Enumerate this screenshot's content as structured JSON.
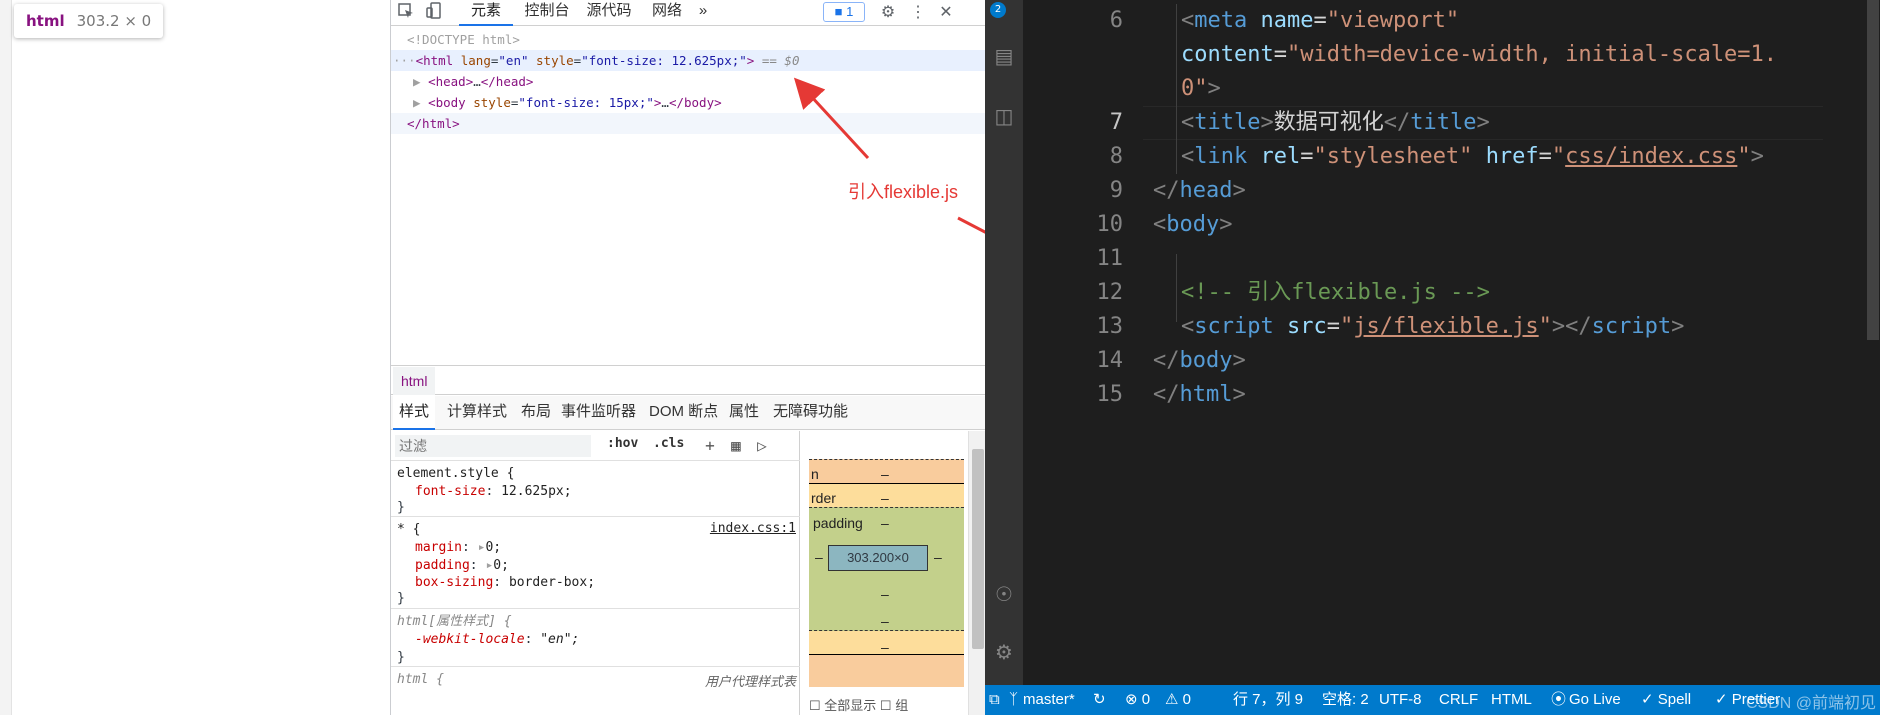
{
  "preview": {
    "tooltip": {
      "tag": "html",
      "dims": "303.2 × 0"
    }
  },
  "devtools": {
    "tabs": [
      "元素",
      "控制台",
      "源代码",
      "网络"
    ],
    "more_tabs": "»",
    "issues_count": "1",
    "dom": {
      "doctype": "<!DOCTYPE html>",
      "html_open": {
        "prefix": "···",
        "tag_open": "<html",
        "attr1_name": "lang",
        "attr1_value": "\"en\"",
        "attr2_name": "style",
        "attr2_value": "\"font-size: 12.625px;\"",
        "tag_close": ">",
        "suffix": "== $0"
      },
      "head_line": {
        "tag_open": "<head>",
        "ellipsis": "…",
        "tag_close": "</head>"
      },
      "body_line": {
        "tag_open": "<body",
        "attr_name": "style",
        "attr_value": "\"font-size: 15px;\"",
        "gt": ">",
        "ellipsis": "…",
        "tag_close": "</body>"
      },
      "html_close": "</html>"
    },
    "breadcrumb": "html",
    "sub_tabs": [
      "样式",
      "计算样式",
      "布局",
      "事件监听器",
      "DOM 断点",
      "属性",
      "无障碍功能"
    ],
    "filter": {
      "placeholder": "过滤",
      "hov": ":hov",
      "cls": ".cls",
      "add": "+"
    },
    "styles": {
      "rule1": {
        "selector": "element.style {",
        "prop": "font-size",
        "value": "12.625px;",
        "close": "}"
      },
      "rule2": {
        "selector": "* {",
        "source": "index.css:1",
        "props": [
          {
            "name": "margin",
            "value": "0;"
          },
          {
            "name": "padding",
            "value": "0;"
          },
          {
            "name": "box-sizing",
            "value": "border-box;"
          }
        ],
        "close": "}"
      },
      "rule3": {
        "selector": "html[属性样式] {",
        "prop": "-webkit-locale",
        "value": "\"en\";",
        "close": "}"
      },
      "rule4": {
        "selector": "html {",
        "source": "用户代理样式表"
      }
    },
    "box_model": {
      "margin_label": "n",
      "margin_value": "–",
      "border_label": "rder",
      "border_value": "–",
      "padding_label": "padding",
      "padding_value": "–",
      "content": "303.200×0",
      "dash": "–",
      "colors": {
        "margin": "#f9cc9d",
        "border": "#fddd9b",
        "padding": "#c3d08b",
        "content": "#8cb6c0"
      }
    },
    "bottom_hint": {
      "show_all": "全部显示",
      "group": "组"
    }
  },
  "annotation": {
    "label": "引入flexible.js",
    "color": "#e53935"
  },
  "vscode": {
    "badge": "2",
    "lines": [
      {
        "n": "6"
      },
      {
        "n": ""
      },
      {
        "n": ""
      },
      {
        "n": "7"
      },
      {
        "n": "8"
      },
      {
        "n": "9"
      },
      {
        "n": "10"
      },
      {
        "n": "11"
      },
      {
        "n": "12"
      },
      {
        "n": "13"
      },
      {
        "n": "14"
      },
      {
        "n": "15"
      }
    ],
    "code": {
      "l6": {
        "lt": "<",
        "tag": "meta",
        "attr": "name",
        "eq": "=",
        "val": "\"viewport\""
      },
      "l6b": {
        "attr": "content",
        "eq": "=",
        "val": "\"width=device-width, initial-scale=1."
      },
      "l6c": {
        "val": "0\"",
        "gt": ">"
      },
      "l7": {
        "lt": "<",
        "tag": "title",
        "gt": ">",
        "text": "数据可视化",
        "lt2": "</",
        "tag2": "title",
        "gt2": ">"
      },
      "l8": {
        "lt": "<",
        "tag": "link",
        "attr1": "rel",
        "eq1": "=",
        "val1": "\"stylesheet\"",
        "attr2": "href",
        "eq2": "=",
        "q1": "\"",
        "link": "css/index.css",
        "q2": "\"",
        "gt": ">"
      },
      "l9": {
        "lt": "</",
        "tag": "head",
        "gt": ">"
      },
      "l10": {
        "lt": "<",
        "tag": "body",
        "gt": ">"
      },
      "l12": {
        "comment": "<!-- 引入flexible.js -->"
      },
      "l13": {
        "lt": "<",
        "tag": "script",
        "attr": "src",
        "eq": "=",
        "q1": "\"",
        "link": "js/flexible.js",
        "q2": "\"",
        "gt": ">",
        "lt2": "</",
        "tag2": "script",
        "gt2": ">"
      },
      "l14": {
        "lt": "</",
        "tag": "body",
        "gt": ">"
      },
      "l15": {
        "lt": "</",
        "tag": "html",
        "gt": ">"
      }
    },
    "status": {
      "branch": "master*",
      "errors": "⊗ 0",
      "warnings": "⚠ 0",
      "position": "行 7，列 9",
      "spaces": "空格: 2",
      "encoding": "UTF-8",
      "eol": "CRLF",
      "language": "HTML",
      "golive": "Go Live",
      "spell": "✓ Spell",
      "prettier": "✓ Prettier"
    },
    "watermark": "CSDN @前端初见"
  }
}
